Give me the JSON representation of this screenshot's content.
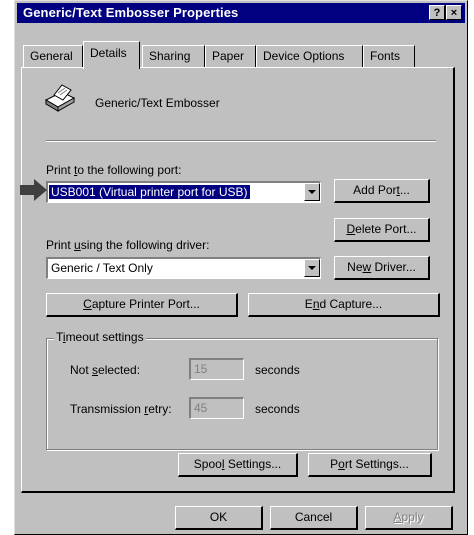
{
  "window": {
    "title": "Generic/Text Embosser Properties",
    "help_label": "?",
    "close_label": "×"
  },
  "tabs": [
    {
      "label": "General",
      "active": false
    },
    {
      "label": "Details",
      "active": true
    },
    {
      "label": "Sharing",
      "active": false
    },
    {
      "label": "Paper",
      "active": false
    },
    {
      "label": "Device Options",
      "active": false
    },
    {
      "label": "Fonts",
      "active": false
    }
  ],
  "details": {
    "printer_name": "Generic/Text Embosser",
    "port_label": "Print to the following port:",
    "port_value": "USB001  (Virtual printer port for USB)",
    "add_port": "Add Port...",
    "delete_port": "Delete Port...",
    "driver_label": "Print using the following driver:",
    "driver_value": "Generic / Text Only",
    "new_driver": "New Driver...",
    "capture_port": "Capture Printer Port...",
    "end_capture": "End Capture...",
    "timeout_group": "Timeout settings",
    "not_selected_label": "Not selected:",
    "not_selected_value": "15",
    "not_selected_unit": "seconds",
    "retry_label": "Transmission retry:",
    "retry_value": "45",
    "retry_unit": "seconds",
    "spool_settings": "Spool Settings...",
    "port_settings": "Port Settings..."
  },
  "footer": {
    "ok": "OK",
    "cancel": "Cancel",
    "apply": "Apply"
  }
}
